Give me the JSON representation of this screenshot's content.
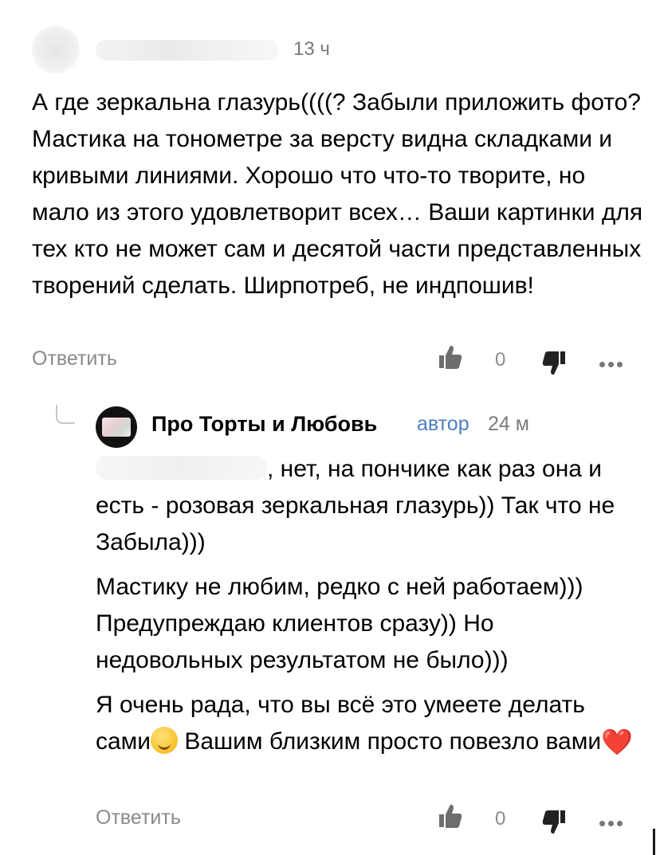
{
  "main_comment": {
    "time": "13 ч",
    "text": "А где зеркальна глазурь((((? Забыли приложить фото? Мастика на тонометре за версту видна складками и кривыми линиями. Хорошо что что-то творите, но мало из этого удовлетворит всех… Ваши картинки для тех кто не может сам и десятой части представленных творений сделать. Ширпотреб, не индпошив!",
    "reply_label": "Ответить",
    "rating": "0"
  },
  "reply_comment": {
    "author": "Про Торты и Любовь",
    "badge": "автор",
    "time": "24 м",
    "para1_rest": ", нет, на пончике как раз она и есть - розовая зеркальная глазурь)) Так что не Забыла)))",
    "para2": "Мастику не любим, редко с ней работаем))) Предупреждаю клиентов сразу)) Но недовольных результатом не было)))",
    "para3_a": "Я очень рада, что вы всё это умеете делать сами",
    "para3_b": " Вашим близким просто повезло вами",
    "heart": "❤️",
    "reply_label": "Ответить",
    "rating": "0"
  },
  "icons": [
    "like-icon",
    "dislike-icon",
    "more-icon",
    "hug-emoji-icon",
    "heart-emoji-icon"
  ],
  "colors": {
    "muted": "#8a8a8a",
    "author_badge": "#4a7fc1",
    "heart": "#e0201c"
  }
}
